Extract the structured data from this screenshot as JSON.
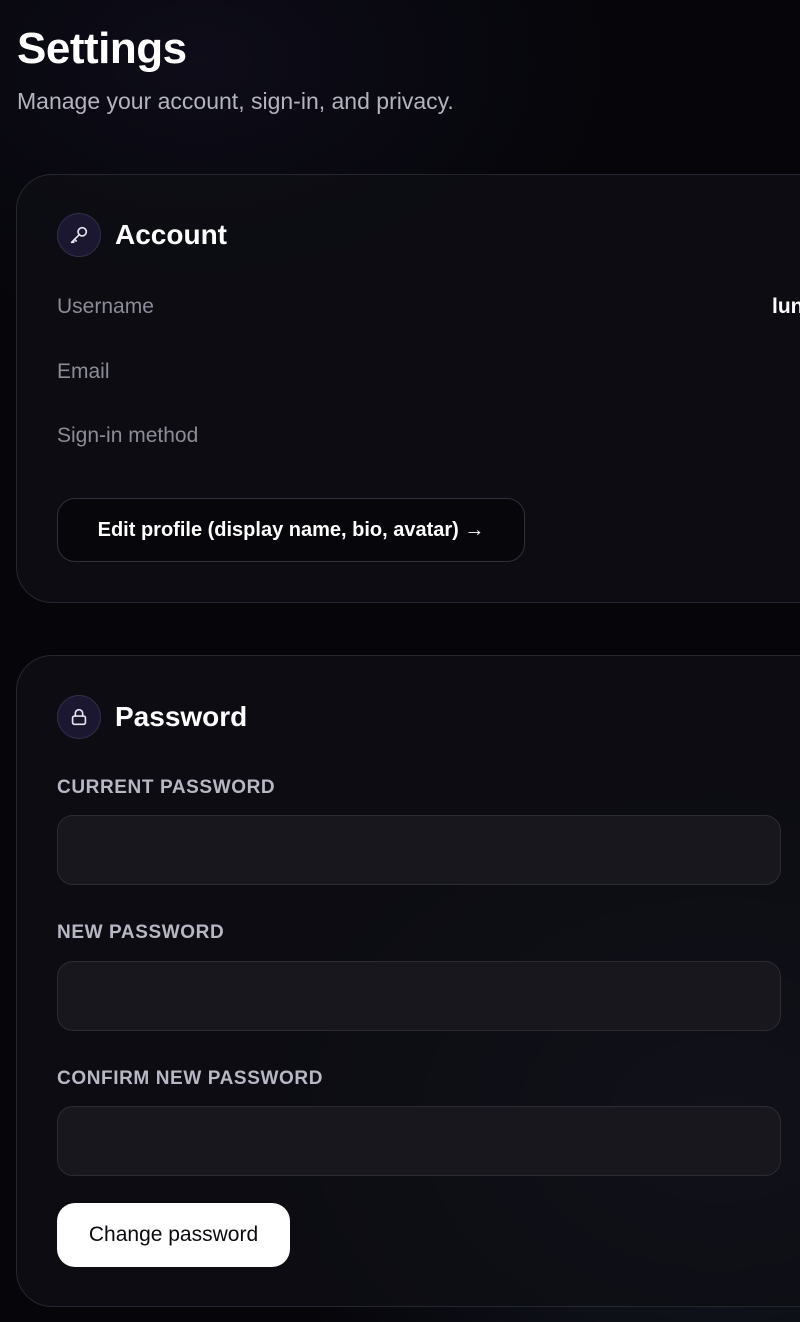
{
  "header": {
    "title": "Settings",
    "subtitle": "Manage your account, sign-in, and privacy."
  },
  "account": {
    "title": "Account",
    "icon": "key-icon",
    "fields": [
      {
        "label": "Username",
        "value": "lun"
      },
      {
        "label": "Email",
        "value": ""
      },
      {
        "label": "Sign-in method",
        "value": ""
      }
    ],
    "edit_button_label": "Edit profile (display name, bio, avatar) →"
  },
  "password": {
    "title": "Password",
    "icon": "lock-icon",
    "current_label": "CURRENT PASSWORD",
    "current_value": "",
    "new_label": "NEW PASSWORD",
    "new_value": "",
    "confirm_label": "CONFIRM NEW PASSWORD",
    "confirm_value": "",
    "submit_label": "Change password"
  },
  "colors": {
    "background": "#05050a",
    "card": "#0e0e14",
    "icon_bg": "#1b1730",
    "primary_button": "#ffffff"
  }
}
